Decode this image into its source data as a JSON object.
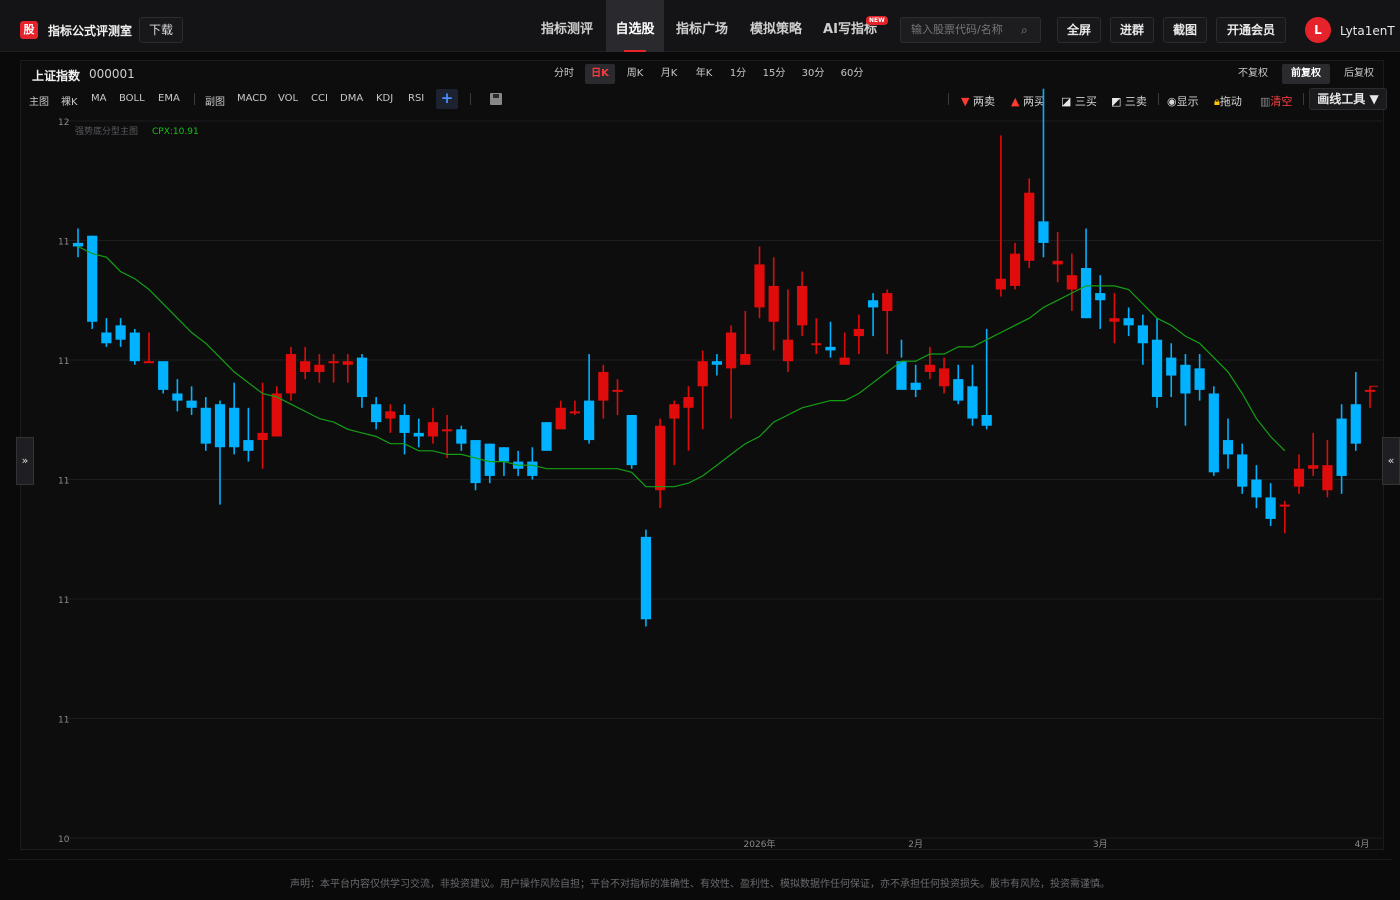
{
  "header": {
    "logo_text": "股",
    "brand": "指标公式评测室",
    "download": "下载",
    "nav": [
      "指标测评",
      "自选股",
      "指标广场",
      "模拟策略",
      "AI写指标"
    ],
    "nav_active": 1,
    "new_badge": "NEW",
    "search_placeholder": "输入股票代码/名称",
    "buttons": [
      "全屏",
      "进群",
      "截图",
      "开通会员"
    ],
    "avatar_letter": "L",
    "username": "Lyta1enT"
  },
  "stock": {
    "name": "上证指数",
    "code": "000001"
  },
  "periods": [
    "分时",
    "日K",
    "周K",
    "月K",
    "年K",
    "1分",
    "15分",
    "30分",
    "60分"
  ],
  "period_active": 1,
  "adjust": [
    "不复权",
    "前复权",
    "后复权"
  ],
  "adjust_active": 1,
  "indicators_main": [
    "主图",
    "裸K",
    "MA",
    "BOLL",
    "EMA"
  ],
  "indicators_sub": [
    "副图",
    "MACD",
    "VOL",
    "CCI",
    "DMA",
    "KDJ",
    "RSI"
  ],
  "plus": "+",
  "tools": {
    "sell2": "两卖",
    "buy2": "两买",
    "buy3": "三买",
    "sell3": "三卖",
    "show": "显示",
    "drag": "拖动",
    "clear": "清空",
    "draw": "画线工具 ▼"
  },
  "legend": {
    "name": "强势底分型主图",
    "cpx": "CPX:10.91"
  },
  "side": {
    "left": "»",
    "right": "«"
  },
  "disclaimer": "声明：本平台内容仅供学习交流，非投资建议。用户操作风险自担；平台不对指标的准确性、有效性、盈利性、模拟数据作任何保证，亦不承担任何投资损失。股市有风险，投资需谨慎。",
  "colors": {
    "up": "#e00b0b",
    "down": "#00b2ff",
    "ma": "#14a014",
    "accent": "#e6222b"
  },
  "chart_data": {
    "type": "candlestick",
    "y_tick_labels": [
      "12",
      "11",
      "11",
      "11",
      "11",
      "11",
      "10"
    ],
    "x_tick_labels": [
      "2026年",
      "2月",
      "3月",
      "4月"
    ],
    "x_tick_index": [
      48,
      59,
      72,
      94
    ],
    "y_range": [
      10.0,
      12.0
    ],
    "candles": [
      [
        11.66,
        11.65,
        11.7,
        11.62
      ],
      [
        11.68,
        11.44,
        11.68,
        11.42
      ],
      [
        11.41,
        11.38,
        11.45,
        11.37
      ],
      [
        11.43,
        11.39,
        11.45,
        11.37
      ],
      [
        11.41,
        11.33,
        11.42,
        11.32
      ],
      [
        11.33,
        11.33,
        11.41,
        11.33
      ],
      [
        11.33,
        11.25,
        11.33,
        11.24
      ],
      [
        11.24,
        11.22,
        11.28,
        11.19
      ],
      [
        11.22,
        11.2,
        11.26,
        11.18
      ],
      [
        11.2,
        11.1,
        11.23,
        11.08
      ],
      [
        11.21,
        11.09,
        11.22,
        10.93
      ],
      [
        11.2,
        11.09,
        11.27,
        11.07
      ],
      [
        11.11,
        11.08,
        11.2,
        11.05
      ],
      [
        11.11,
        11.13,
        11.27,
        11.03
      ],
      [
        11.12,
        11.24,
        11.26,
        11.12
      ],
      [
        11.24,
        11.35,
        11.37,
        11.22
      ],
      [
        11.3,
        11.33,
        11.37,
        11.28
      ],
      [
        11.3,
        11.32,
        11.35,
        11.27
      ],
      [
        11.33,
        11.33,
        11.35,
        11.27
      ],
      [
        11.32,
        11.33,
        11.35,
        11.27
      ],
      [
        11.34,
        11.23,
        11.35,
        11.2
      ],
      [
        11.21,
        11.16,
        11.23,
        11.14
      ],
      [
        11.17,
        11.19,
        11.21,
        11.13
      ],
      [
        11.18,
        11.13,
        11.21,
        11.07
      ],
      [
        11.13,
        11.12,
        11.17,
        11.09
      ],
      [
        11.12,
        11.16,
        11.2,
        11.1
      ],
      [
        11.14,
        11.14,
        11.18,
        11.06
      ],
      [
        11.14,
        11.1,
        11.15,
        11.08
      ],
      [
        11.11,
        10.99,
        11.11,
        10.97
      ],
      [
        11.1,
        11.01,
        11.1,
        10.99
      ],
      [
        11.09,
        11.05,
        11.09,
        11.01
      ],
      [
        11.05,
        11.03,
        11.08,
        11.01
      ],
      [
        11.05,
        11.01,
        11.09,
        11.0
      ],
      [
        11.16,
        11.08,
        11.16,
        11.08
      ],
      [
        11.14,
        11.2,
        11.22,
        11.15
      ],
      [
        11.19,
        11.19,
        11.22,
        11.18
      ],
      [
        11.22,
        11.11,
        11.35,
        11.1
      ],
      [
        11.22,
        11.3,
        11.32,
        11.17
      ],
      [
        11.25,
        11.25,
        11.28,
        11.18
      ],
      [
        11.18,
        11.04,
        11.18,
        11.03
      ],
      [
        10.84,
        10.61,
        10.86,
        10.59
      ],
      [
        10.97,
        11.15,
        11.17,
        10.92
      ],
      [
        11.17,
        11.21,
        11.22,
        11.04
      ],
      [
        11.2,
        11.23,
        11.26,
        11.08
      ],
      [
        11.26,
        11.33,
        11.36,
        11.14
      ],
      [
        11.33,
        11.32,
        11.35,
        11.29
      ],
      [
        11.31,
        11.41,
        11.43,
        11.17
      ],
      [
        11.32,
        11.35,
        11.47,
        11.32
      ],
      [
        11.48,
        11.6,
        11.65,
        11.45
      ],
      [
        11.44,
        11.54,
        11.62,
        11.36
      ],
      [
        11.33,
        11.39,
        11.53,
        11.3
      ],
      [
        11.43,
        11.54,
        11.58,
        11.4
      ],
      [
        11.38,
        11.38,
        11.45,
        11.35
      ],
      [
        11.37,
        11.36,
        11.44,
        11.34
      ],
      [
        11.32,
        11.34,
        11.41,
        11.32
      ],
      [
        11.4,
        11.42,
        11.46,
        11.35
      ],
      [
        11.5,
        11.48,
        11.52,
        11.4
      ],
      [
        11.47,
        11.52,
        11.53,
        11.35
      ],
      [
        11.33,
        11.25,
        11.39,
        11.34
      ],
      [
        11.27,
        11.25,
        11.32,
        11.23
      ],
      [
        11.3,
        11.32,
        11.37,
        11.28
      ],
      [
        11.26,
        11.31,
        11.34,
        11.24
      ],
      [
        11.28,
        11.22,
        11.32,
        11.21
      ],
      [
        11.26,
        11.17,
        11.32,
        11.15
      ],
      [
        11.18,
        11.15,
        11.42,
        11.14
      ],
      [
        11.53,
        11.56,
        11.96,
        11.51
      ],
      [
        11.54,
        11.63,
        11.66,
        11.53
      ],
      [
        11.61,
        11.8,
        11.84,
        11.59
      ],
      [
        11.72,
        11.66,
        12.09,
        11.62
      ],
      [
        11.6,
        11.61,
        11.69,
        11.55
      ],
      [
        11.53,
        11.57,
        11.63,
        11.47
      ],
      [
        11.59,
        11.45,
        11.7,
        11.45
      ],
      [
        11.52,
        11.5,
        11.57,
        11.42
      ],
      [
        11.44,
        11.45,
        11.52,
        11.38
      ],
      [
        11.45,
        11.43,
        11.48,
        11.4
      ],
      [
        11.43,
        11.38,
        11.46,
        11.32
      ],
      [
        11.39,
        11.23,
        11.45,
        11.2
      ],
      [
        11.34,
        11.29,
        11.38,
        11.23
      ],
      [
        11.32,
        11.24,
        11.35,
        11.15
      ],
      [
        11.31,
        11.25,
        11.35,
        11.22
      ],
      [
        11.24,
        11.02,
        11.26,
        11.01
      ],
      [
        11.11,
        11.07,
        11.17,
        11.03
      ],
      [
        11.07,
        10.98,
        11.1,
        10.96
      ],
      [
        11.0,
        10.95,
        11.04,
        10.92
      ],
      [
        10.95,
        10.89,
        10.99,
        10.87
      ],
      [
        10.93,
        10.93,
        10.94,
        10.85
      ],
      [
        10.98,
        11.03,
        11.07,
        10.96
      ],
      [
        11.03,
        11.04,
        11.13,
        11.01
      ],
      [
        10.97,
        11.04,
        11.11,
        10.95
      ],
      [
        11.17,
        11.01,
        11.21,
        10.96
      ],
      [
        11.21,
        11.1,
        11.3,
        11.08
      ],
      [
        11.25,
        11.25,
        11.26,
        11.2
      ]
    ],
    "ma_label": "CPX",
    "ma": [
      11.65,
      11.63,
      11.62,
      11.58,
      11.56,
      11.53,
      11.49,
      11.45,
      11.41,
      11.38,
      11.34,
      11.3,
      11.27,
      11.24,
      11.23,
      11.21,
      11.19,
      11.17,
      11.16,
      11.14,
      11.13,
      11.12,
      11.1,
      11.1,
      11.08,
      11.08,
      11.07,
      11.07,
      11.06,
      11.05,
      11.05,
      11.04,
      11.04,
      11.03,
      11.03,
      11.03,
      11.03,
      11.03,
      11.03,
      11.02,
      10.98,
      10.98,
      10.98,
      10.99,
      11.01,
      11.04,
      11.07,
      11.1,
      11.12,
      11.16,
      11.18,
      11.2,
      11.21,
      11.22,
      11.22,
      11.24,
      11.27,
      11.3,
      11.33,
      11.33,
      11.35,
      11.35,
      11.37,
      11.37,
      11.39,
      11.41,
      11.43,
      11.45,
      11.48,
      11.5,
      11.52,
      11.54,
      11.54,
      11.54,
      11.53,
      11.49,
      11.45,
      11.43,
      11.4,
      11.38,
      11.34,
      11.3,
      11.24,
      11.17,
      11.12,
      11.08
    ]
  }
}
